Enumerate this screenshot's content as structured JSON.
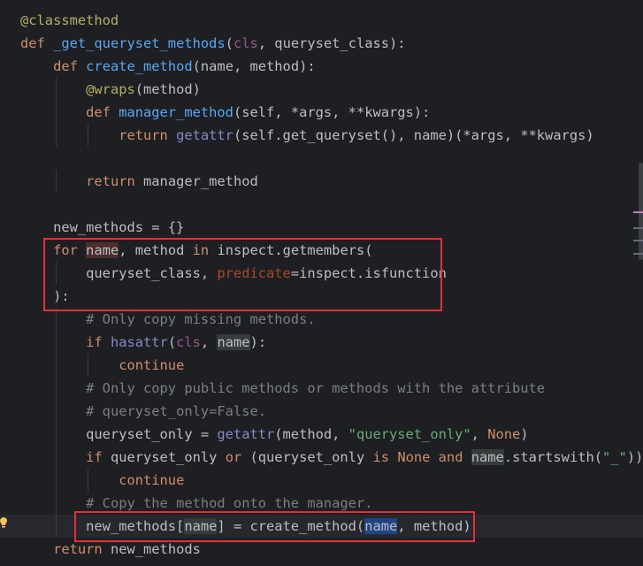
{
  "editor": {
    "lines": [
      [
        [
          "@classmethod",
          "t-dec"
        ]
      ],
      [
        [
          "def ",
          "t-kw"
        ],
        [
          "_get_queryset_methods",
          "t-fn"
        ],
        [
          "(",
          "t-def"
        ],
        [
          "cls",
          "t-self"
        ],
        [
          ", queryset_class):",
          "t-def"
        ]
      ],
      [
        [
          "    ",
          "t-def"
        ],
        [
          "def ",
          "t-kw"
        ],
        [
          "create_method",
          "t-fn"
        ],
        [
          "(name, method):",
          "t-def"
        ]
      ],
      [
        [
          "        ",
          "t-def"
        ],
        [
          "@wraps",
          "t-dec"
        ],
        [
          "(method)",
          "t-def"
        ]
      ],
      [
        [
          "        ",
          "t-def"
        ],
        [
          "def ",
          "t-kw"
        ],
        [
          "manager_method",
          "t-fn"
        ],
        [
          "(self, *args, **kwargs):",
          "t-def"
        ]
      ],
      [
        [
          "            ",
          "t-def"
        ],
        [
          "return ",
          "t-kw"
        ],
        [
          "getattr",
          "t-bi"
        ],
        [
          "(self.get_queryset(), name)(*args, **kwargs)",
          "t-def"
        ]
      ],
      [],
      [
        [
          "        ",
          "t-def"
        ],
        [
          "return ",
          "t-kw"
        ],
        [
          "manager_method",
          "t-def"
        ]
      ],
      [],
      [
        [
          "    new_methods = {}",
          "t-def"
        ]
      ],
      [
        [
          "    ",
          "t-def"
        ],
        [
          "for ",
          "t-kw"
        ],
        [
          "name",
          "t-def hl-write"
        ],
        [
          ", method ",
          "t-def"
        ],
        [
          "in ",
          "t-kw"
        ],
        [
          "inspect.getmembers(",
          "t-def"
        ]
      ],
      [
        [
          "        queryset_class, ",
          "t-def"
        ],
        [
          "predicate",
          "t-par"
        ],
        [
          "=inspect.isfunction",
          "t-def"
        ]
      ],
      [
        [
          "    ):",
          "t-def"
        ]
      ],
      [
        [
          "        ",
          "t-def"
        ],
        [
          "# Only copy missing methods.",
          "t-com"
        ]
      ],
      [
        [
          "        ",
          "t-def"
        ],
        [
          "if ",
          "t-kw"
        ],
        [
          "hasattr",
          "t-bi"
        ],
        [
          "(",
          "t-def"
        ],
        [
          "cls",
          "t-self"
        ],
        [
          ", ",
          "t-def"
        ],
        [
          "name",
          "t-def hl-read"
        ],
        [
          "):",
          "t-def"
        ]
      ],
      [
        [
          "            ",
          "t-def"
        ],
        [
          "continue",
          "t-kw"
        ]
      ],
      [
        [
          "        ",
          "t-def"
        ],
        [
          "# Only copy public methods or methods with the attribute",
          "t-com"
        ]
      ],
      [
        [
          "        ",
          "t-def"
        ],
        [
          "# queryset_only=False.",
          "t-com"
        ]
      ],
      [
        [
          "        queryset_only = ",
          "t-def"
        ],
        [
          "getattr",
          "t-bi"
        ],
        [
          "(method, ",
          "t-def"
        ],
        [
          "\"queryset_only\"",
          "t-str"
        ],
        [
          ", ",
          "t-def"
        ],
        [
          "None",
          "t-kw"
        ],
        [
          ")",
          "t-def"
        ]
      ],
      [
        [
          "        ",
          "t-def"
        ],
        [
          "if ",
          "t-kw"
        ],
        [
          "queryset_only ",
          "t-def"
        ],
        [
          "or ",
          "t-kw"
        ],
        [
          "(queryset_only ",
          "t-def"
        ],
        [
          "is ",
          "t-kw"
        ],
        [
          "None ",
          "t-kw"
        ],
        [
          "and ",
          "t-kw"
        ],
        [
          "name",
          "t-def hl-read"
        ],
        [
          ".startswith(",
          "t-def"
        ],
        [
          "\"_\"",
          "t-str"
        ],
        [
          ")):",
          "t-def"
        ]
      ],
      [
        [
          "            ",
          "t-def"
        ],
        [
          "continue",
          "t-kw"
        ]
      ],
      [
        [
          "        ",
          "t-def"
        ],
        [
          "# Copy the method onto the manager.",
          "t-com"
        ]
      ],
      [
        [
          "        new_methods[",
          "t-def"
        ],
        [
          "name",
          "t-def hl-read"
        ],
        [
          "] = create_method(",
          "t-def"
        ],
        [
          "name",
          "t-def hl-caret"
        ],
        [
          ", method)",
          "t-def"
        ]
      ],
      [
        [
          "    ",
          "t-def"
        ],
        [
          "return ",
          "t-kw"
        ],
        [
          "new_methods",
          "t-def"
        ]
      ]
    ],
    "current_line": 22,
    "highlight_boxes": [
      "for-loop-header-box",
      "new-methods-assignment-box"
    ],
    "colors": {
      "background": "#1e1f22",
      "keyword": "#cf8e6d",
      "function": "#56a8f5",
      "decorator": "#b3ae60",
      "string": "#6aab73",
      "comment": "#7a7e85",
      "annotation_box": "#e0313a"
    },
    "gutter_icon": "lightbulb-icon"
  }
}
